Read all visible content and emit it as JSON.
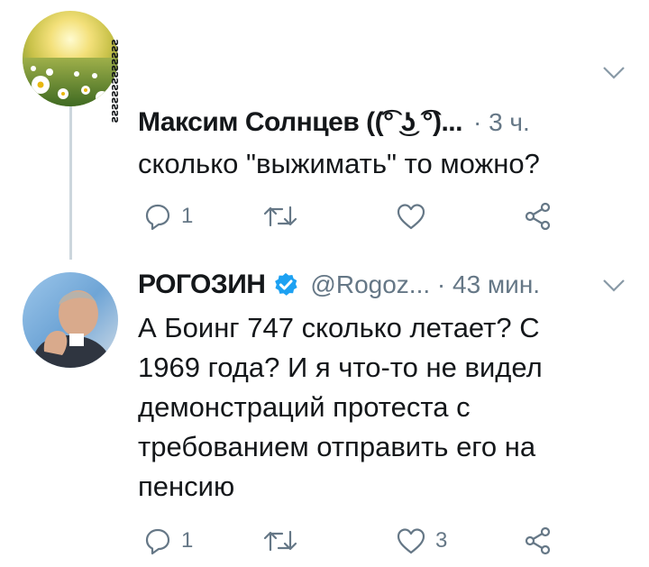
{
  "tweets": [
    {
      "author_name": "Максим Солнцев ((͡° ͜ʖ ͡°)...",
      "meta": "· 3 ч.",
      "side_text": "ƨƨƨƨƨƨƨƨƨƨƨƨƨ",
      "text_lines": [
        "сколько \"выжимать\" то можно?"
      ],
      "actions": {
        "reply_count": "1",
        "retweet_count": "",
        "like_count": ""
      },
      "avatar_icon": "daisies-photo-avatar"
    },
    {
      "author_name": "РОГОЗИН",
      "verified": true,
      "meta": "@Rogoz... · 43 мин.",
      "text_lines": [
        "А Боинг 747 сколько летает? С",
        "1969 года? И я что-то не видел",
        "демонстраций протеста с",
        "требованием отправить его на",
        "пенсию"
      ],
      "actions": {
        "reply_count": "1",
        "retweet_count": "",
        "like_count": "3"
      },
      "avatar_icon": "person-photo-avatar"
    }
  ],
  "colors": {
    "text": "#14171a",
    "muted": "#657786",
    "verified": "#1da1f2",
    "thread_line": "#ccd6dd"
  }
}
